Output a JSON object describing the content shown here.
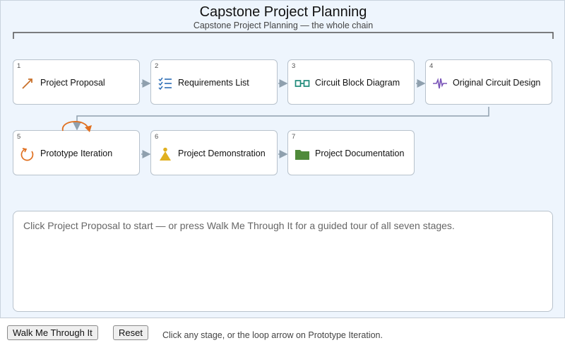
{
  "header": {
    "title": "Capstone Project Planning",
    "subtitle": "Capstone Project Planning — the whole chain"
  },
  "stages": [
    {
      "number": "1",
      "label": "Project Proposal",
      "icon": "trend-arrow-icon",
      "color": "#c8702a"
    },
    {
      "number": "2",
      "label": "Requirements List",
      "icon": "checklist-icon",
      "color": "#2c6db5"
    },
    {
      "number": "3",
      "label": "Circuit Block Diagram",
      "icon": "block-diagram-icon",
      "color": "#1f8a7a"
    },
    {
      "number": "4",
      "label": "Original Circuit Design",
      "icon": "waveform-icon",
      "color": "#7a55b8"
    },
    {
      "number": "5",
      "label": "Prototype Iteration",
      "icon": "cycle-icon",
      "color": "#e07020"
    },
    {
      "number": "6",
      "label": "Project Demonstration",
      "icon": "presenter-icon",
      "color": "#e0b020"
    },
    {
      "number": "7",
      "label": "Project Documentation",
      "icon": "folder-icon",
      "color": "#4f8a3a"
    }
  ],
  "info": {
    "message": "Click Project Proposal to start — or press Walk Me Through It for a guided tour of all seven stages."
  },
  "controls": {
    "walk_label": "Walk Me Through It",
    "reset_label": "Reset",
    "hint": "Click any stage, or the loop arrow on Prototype Iteration."
  },
  "colors": {
    "panel_bg": "#eef5fd",
    "connector": "#8fa0ae",
    "loop": "#e07020"
  }
}
